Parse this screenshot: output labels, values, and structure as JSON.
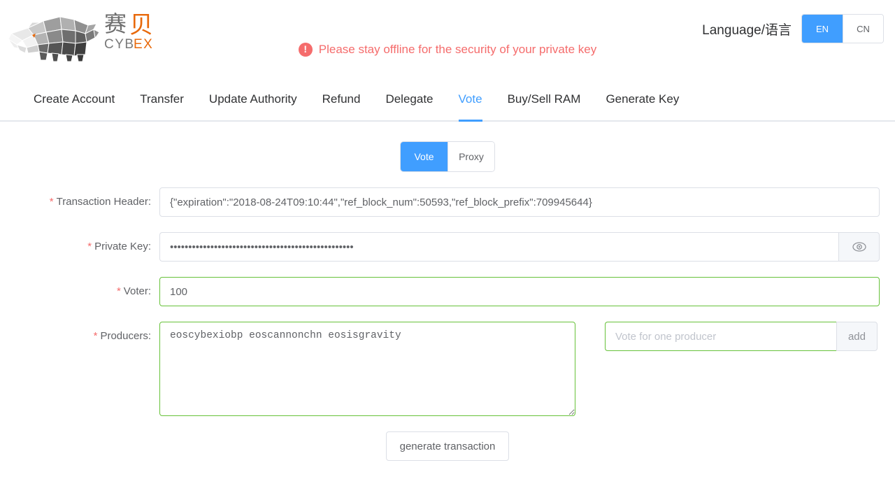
{
  "brand": {
    "name_cn": "赛贝",
    "name_en": "CYBEX",
    "logo_icon": "rhino-logo-icon"
  },
  "header": {
    "warning_text": "Please stay offline for the security of your private key",
    "warning_icon": "exclamation-circle-icon",
    "warning_color": "#f56c6c",
    "language_label": "Language/语言",
    "languages": [
      {
        "code": "EN",
        "active": true
      },
      {
        "code": "CN",
        "active": false
      }
    ]
  },
  "nav": {
    "items": [
      {
        "label": "Create Account",
        "active": false
      },
      {
        "label": "Transfer",
        "active": false
      },
      {
        "label": "Update Authority",
        "active": false
      },
      {
        "label": "Refund",
        "active": false
      },
      {
        "label": "Delegate",
        "active": false
      },
      {
        "label": "Vote",
        "active": true
      },
      {
        "label": "Buy/Sell RAM",
        "active": false
      },
      {
        "label": "Generate Key",
        "active": false
      }
    ],
    "active_color": "#409eff"
  },
  "mode_toggle": {
    "options": [
      {
        "label": "Vote",
        "active": true
      },
      {
        "label": "Proxy",
        "active": false
      }
    ]
  },
  "form": {
    "transaction_header": {
      "label": "Transaction Header:",
      "required": true,
      "value": "{\"expiration\":\"2018-08-24T09:10:44\",\"ref_block_num\":50593,\"ref_block_prefix\":709945644}",
      "placeholder": ""
    },
    "private_key": {
      "label": "Private Key:",
      "required": true,
      "value": "••••••••••••••••••••••••••••••••••••••••••••••••••",
      "placeholder": "",
      "toggle_icon": "eye-icon"
    },
    "voter": {
      "label": "Voter:",
      "required": true,
      "value": "100",
      "placeholder": "",
      "state": "valid"
    },
    "producers": {
      "label": "Producers:",
      "required": true,
      "value": "eoscybexiobp eoscannonchn eosisgravity",
      "state": "valid"
    },
    "producer_add": {
      "placeholder": "Vote for one producer",
      "value": "",
      "button_label": "add",
      "state": "valid"
    },
    "submit_label": "generate transaction"
  },
  "colors": {
    "primary": "#409eff",
    "danger": "#f56c6c",
    "success": "#67c23a",
    "border": "#dcdfe6",
    "text": "#606266"
  }
}
